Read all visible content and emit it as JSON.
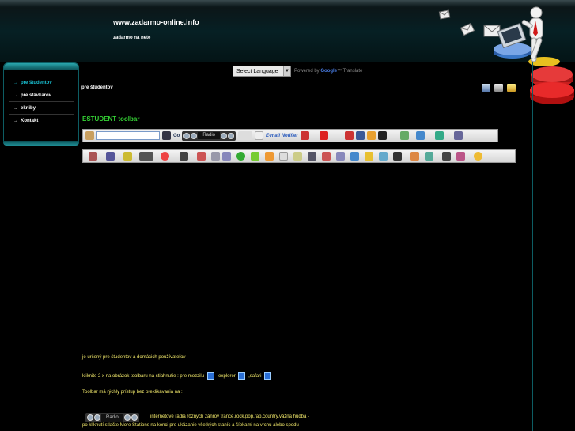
{
  "header": {
    "site_title": "www.zadarmo-online.info",
    "site_subtitle": "zadarmo na nete"
  },
  "sidebar": {
    "items": [
      {
        "label": "pre študentov",
        "active": true
      },
      {
        "label": "pre stávkarov",
        "active": false
      },
      {
        "label": "ekniby",
        "active": false
      },
      {
        "label": "Kontakt",
        "active": false
      }
    ],
    "arrow": "→"
  },
  "translate": {
    "select_label": "Select Language",
    "powered_by": "Powered by",
    "brand": "Google",
    "tm": "™",
    "service": "Translate"
  },
  "page": {
    "heading": "pre študentov",
    "section_title": "ESTUDENT toolbar"
  },
  "toolbar": {
    "go_label": "Go",
    "radio_label": "Radio",
    "email_label": "E-mail Notifier"
  },
  "content": {
    "line1": "je určený pre študentov a domácich používateľov",
    "line2_a": "kliknite 2 x na obrázok toolbaru na stiahnutie : pre mozzilu",
    "line2_b": ",explorer",
    "line2_c": ",safari",
    "line3": "Toolbar má rýchly prístup bez preklikávania na :",
    "line4": "internetové rádiá rôznych žánrov trance,rock,pop,rap,country,vážna hudba -",
    "line5": "po kliknutí stlačte More Stations na konci pre ukázanie všetkých staníc a šípkami na vrchu alebo spodu"
  },
  "colors": {
    "accent": "#19c0d2",
    "section_title": "#35d335",
    "content_text": "#f2e96b"
  }
}
